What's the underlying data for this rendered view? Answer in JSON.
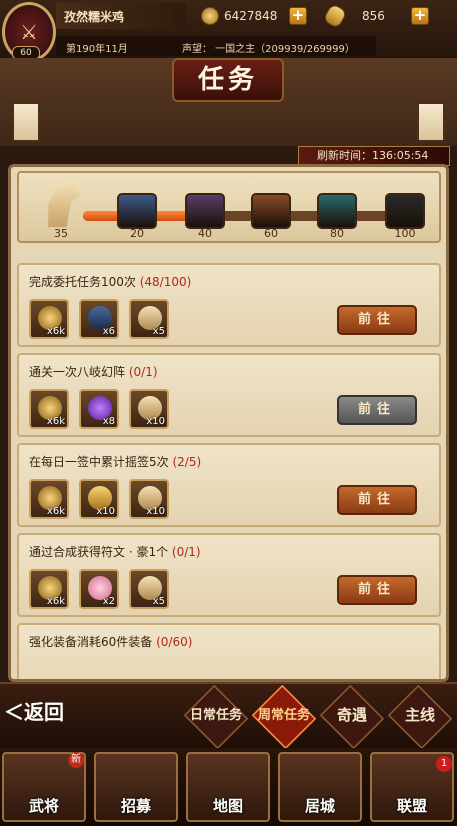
{
  "player": {
    "name": "孜然糯米鸡",
    "level": "60",
    "coins": "6427848",
    "gold": "856",
    "date": "第190年11月",
    "fame": "声望： 一国之主（209939/269999）"
  },
  "page": {
    "title": "任务",
    "refresh": "刷新时间：136:05:54"
  },
  "milestones": {
    "current": 35,
    "max": 100,
    "labels": [
      "35",
      "20",
      "40",
      "60",
      "80",
      "100"
    ],
    "chest_colors": [
      "#3c5a8a",
      "#5a3c6a",
      "#8a4a2a",
      "#2a6a6a",
      "#2a2a2a"
    ]
  },
  "tasks": [
    {
      "title": "完成委托任务100次",
      "progress": "(48/100)",
      "rewards": [
        "x6k",
        "x6",
        "x5"
      ],
      "reward_icons": [
        "coin-icon",
        "chest-icon",
        "horse-icon"
      ],
      "button": "前往",
      "disabled": false
    },
    {
      "title": "通关一次八岐幻阵",
      "progress": "(0/1)",
      "rewards": [
        "x6k",
        "x8",
        "x10"
      ],
      "reward_icons": [
        "coin-icon",
        "magatama-icon",
        "horse-icon"
      ],
      "button": "前往",
      "disabled": true
    },
    {
      "title": "在每日一签中累计摇签5次",
      "progress": "(2/5)",
      "rewards": [
        "x6k",
        "x10",
        "x10"
      ],
      "reward_icons": [
        "coin-icon",
        "gold-ingot-icon",
        "horse-icon"
      ],
      "button": "前往",
      "disabled": false
    },
    {
      "title": "通过合成获得符文 · 豪1个",
      "progress": "(0/1)",
      "rewards": [
        "x6k",
        "x2",
        "x5"
      ],
      "reward_icons": [
        "coin-icon",
        "rune-icon",
        "horse-icon"
      ],
      "button": "前往",
      "disabled": false
    },
    {
      "title": "强化装备消耗60件装备",
      "progress": "(0/60)",
      "rewards": [],
      "reward_icons": [],
      "button": "",
      "disabled": false
    }
  ],
  "tabs": {
    "back": "＜返回",
    "daily": "日常任务",
    "weekly": "周常任务",
    "adventure": "奇遇",
    "main": "主线"
  },
  "nav": {
    "generals": "武将",
    "recruit": "招募",
    "map": "地图",
    "castle": "居城",
    "alliance": "联盟",
    "new_badge": "新",
    "alliance_badge": "1"
  }
}
